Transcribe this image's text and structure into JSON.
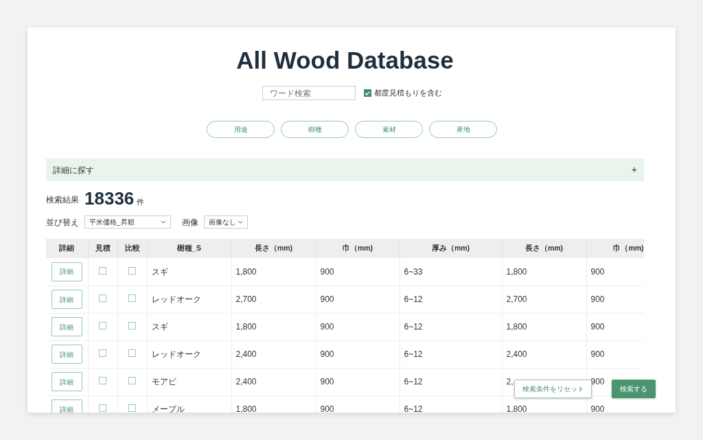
{
  "title": "All Wood Database",
  "search": {
    "placeholder": "ワード検索"
  },
  "include_estimate": {
    "label": "都度見積もりを含む",
    "checked": true
  },
  "categories": [
    {
      "label": "用途"
    },
    {
      "label": "樹種"
    },
    {
      "label": "素材"
    },
    {
      "label": "産地"
    }
  ],
  "detail_search": {
    "label": "詳細に探す",
    "toggle": "+"
  },
  "result": {
    "label": "検索結果",
    "count": "18336",
    "unit": "件"
  },
  "sort": {
    "label": "並び替え",
    "value": "平米価格_昇順"
  },
  "image": {
    "label": "画像",
    "value": "画像なし"
  },
  "table": {
    "columns": [
      "詳細",
      "見積",
      "比較",
      "樹種_S",
      "長さ（mm)",
      "巾（mm)",
      "厚み（mm)",
      "長さ（mm)",
      "巾（mm)"
    ],
    "rows": [
      {
        "cells": [
          {
            "kind": "button",
            "text": "詳細"
          },
          {
            "kind": "checkbox",
            "checked": false
          },
          {
            "kind": "checkbox",
            "checked": false
          },
          {
            "kind": "text",
            "text": "スギ"
          },
          {
            "kind": "text",
            "text": "1,800"
          },
          {
            "kind": "text",
            "text": "900"
          },
          {
            "kind": "text",
            "text": "6~33"
          },
          {
            "kind": "text",
            "text": "1,800"
          },
          {
            "kind": "text",
            "text": "900"
          }
        ]
      },
      {
        "cells": [
          {
            "kind": "button",
            "text": "詳細"
          },
          {
            "kind": "checkbox",
            "checked": false
          },
          {
            "kind": "checkbox",
            "checked": false
          },
          {
            "kind": "text",
            "text": "レッドオーク"
          },
          {
            "kind": "text",
            "text": "2,700"
          },
          {
            "kind": "text",
            "text": "900"
          },
          {
            "kind": "text",
            "text": "6~12"
          },
          {
            "kind": "text",
            "text": "2,700"
          },
          {
            "kind": "text",
            "text": "900"
          }
        ]
      },
      {
        "cells": [
          {
            "kind": "button",
            "text": "詳細"
          },
          {
            "kind": "checkbox",
            "checked": false
          },
          {
            "kind": "checkbox",
            "checked": false
          },
          {
            "kind": "text",
            "text": "スギ"
          },
          {
            "kind": "text",
            "text": "1,800"
          },
          {
            "kind": "text",
            "text": "900"
          },
          {
            "kind": "text",
            "text": "6~12"
          },
          {
            "kind": "text",
            "text": "1,800"
          },
          {
            "kind": "text",
            "text": "900"
          }
        ]
      },
      {
        "cells": [
          {
            "kind": "button",
            "text": "詳細"
          },
          {
            "kind": "checkbox",
            "checked": false
          },
          {
            "kind": "checkbox",
            "checked": false
          },
          {
            "kind": "text",
            "text": "レッドオーク"
          },
          {
            "kind": "text",
            "text": "2,400"
          },
          {
            "kind": "text",
            "text": "900"
          },
          {
            "kind": "text",
            "text": "6~12"
          },
          {
            "kind": "text",
            "text": "2,400"
          },
          {
            "kind": "text",
            "text": "900"
          }
        ]
      },
      {
        "cells": [
          {
            "kind": "button",
            "text": "詳細"
          },
          {
            "kind": "checkbox",
            "checked": false
          },
          {
            "kind": "checkbox",
            "checked": false
          },
          {
            "kind": "text",
            "text": "モアビ"
          },
          {
            "kind": "text",
            "text": "2,400"
          },
          {
            "kind": "text",
            "text": "900"
          },
          {
            "kind": "text",
            "text": "6~12"
          },
          {
            "kind": "text",
            "text": "2,"
          },
          {
            "kind": "text",
            "text": "900"
          }
        ]
      },
      {
        "cells": [
          {
            "kind": "button",
            "text": "詳細"
          },
          {
            "kind": "checkbox",
            "checked": false
          },
          {
            "kind": "checkbox",
            "checked": false
          },
          {
            "kind": "text",
            "text": "メープル"
          },
          {
            "kind": "text",
            "text": "1,800"
          },
          {
            "kind": "text",
            "text": "900"
          },
          {
            "kind": "text",
            "text": "6~12"
          },
          {
            "kind": "text",
            "text": "1,800"
          },
          {
            "kind": "text",
            "text": "900"
          }
        ]
      }
    ]
  },
  "actions": {
    "reset": "検索条件をリセット",
    "search": "検索する"
  }
}
